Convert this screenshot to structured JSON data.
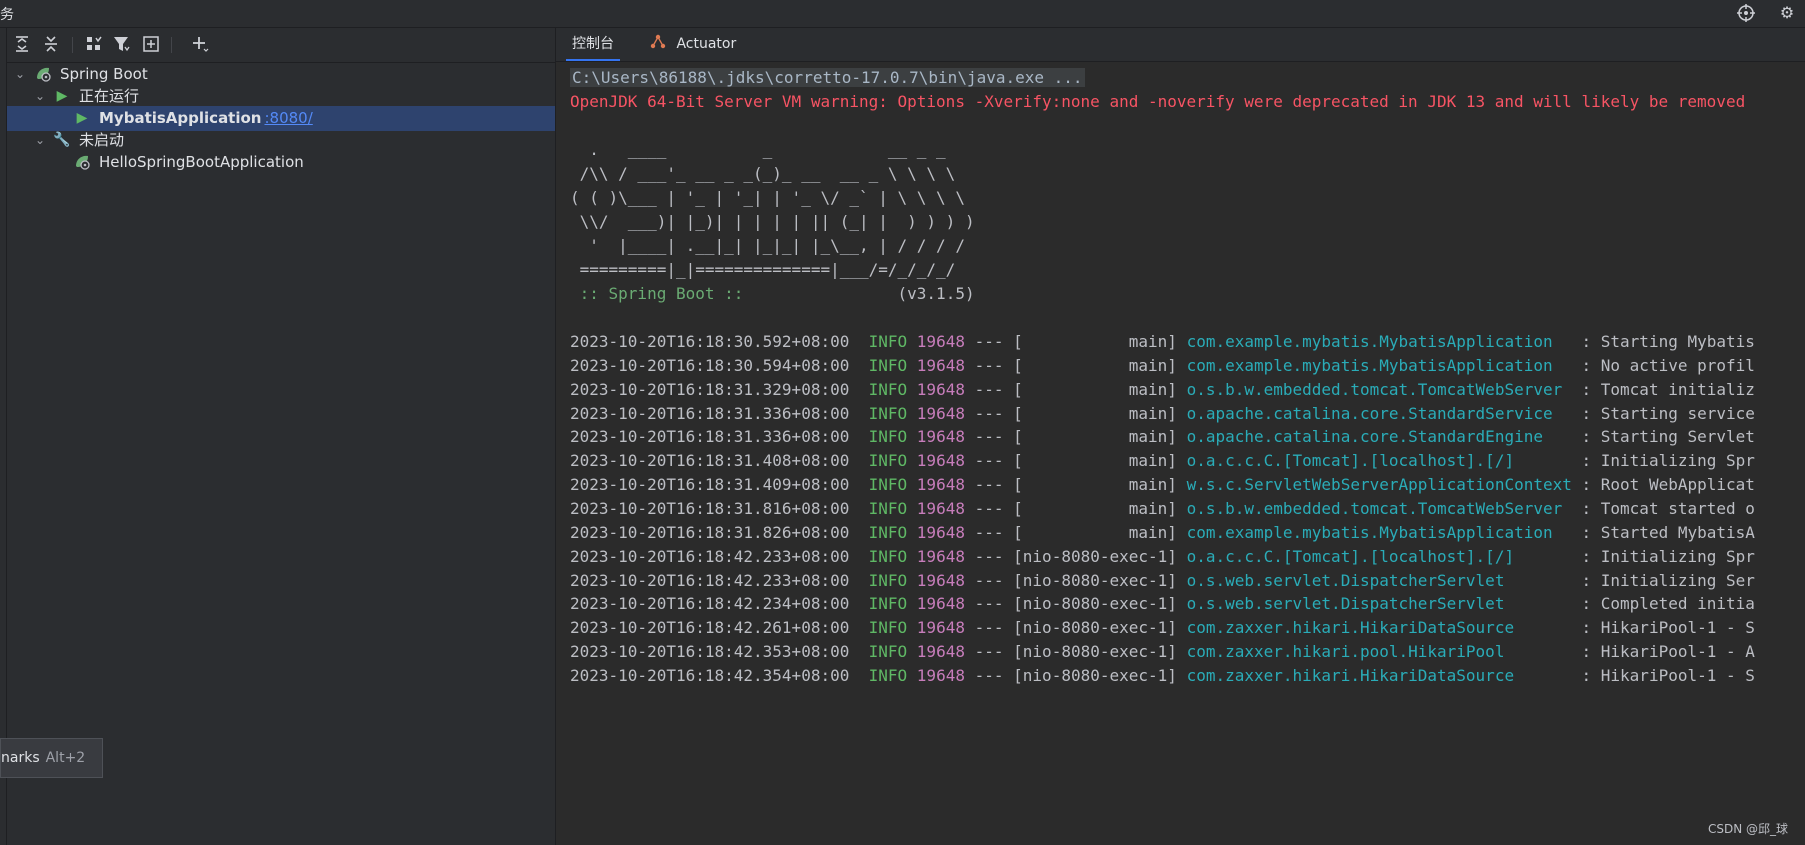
{
  "titlebar": {
    "title": "务",
    "target_icon": "target-icon",
    "gear_icon": "gear-icon"
  },
  "toolbar": {
    "icons": [
      "expand-all-icon",
      "collapse-all-icon",
      "group-by-icon",
      "filter-icon",
      "new-tab-icon",
      "add-icon"
    ]
  },
  "tree": {
    "root": {
      "label": "Spring Boot",
      "icon": "spring-boot-icon"
    },
    "running": {
      "label": "正在运行",
      "icon": "run-icon"
    },
    "app_running": {
      "label": "MybatisApplication",
      "port": ":8080/"
    },
    "not_started": {
      "label": "未启动",
      "icon": "wrench-icon"
    },
    "app_stopped": {
      "label": "HelloSpringBootApplication"
    }
  },
  "tooltip": {
    "label": "narks",
    "shortcut": "Alt+2"
  },
  "tabs": {
    "console": "控制台",
    "actuator": "Actuator"
  },
  "console": {
    "command": "C:\\Users\\86188\\.jdks\\corretto-17.0.7\\bin\\java.exe ...",
    "warning": "OpenJDK 64-Bit Server VM warning: Options -Xverify:none and -noverify were deprecated in JDK 13 and will likely be removed",
    "banner": [
      "  .   ____          _            __ _ _",
      " /\\\\ / ___'_ __ _ _(_)_ __  __ _ \\ \\ \\ \\",
      "( ( )\\___ | '_ | '_| | '_ \\/ _` | \\ \\ \\ \\",
      " \\\\/  ___)| |_)| | | | | || (_| |  ) ) ) )",
      "  '  |____| .__|_| |_|_| |_\\__, | / / / /",
      " =========|_|==============|___/=/_/_/_/"
    ],
    "spring_label": " :: Spring Boot :: ",
    "spring_version": "               (v3.1.5)",
    "logs": [
      {
        "ts": "2023-10-20T16:18:30.592+08:00",
        "level": "INFO",
        "pid": "19648",
        "sep": "---",
        "thread": "[           main]",
        "cls": "com.example.mybatis.MybatisApplication  ",
        "msg": " : Starting Mybatis"
      },
      {
        "ts": "2023-10-20T16:18:30.594+08:00",
        "level": "INFO",
        "pid": "19648",
        "sep": "---",
        "thread": "[           main]",
        "cls": "com.example.mybatis.MybatisApplication  ",
        "msg": " : No active profil"
      },
      {
        "ts": "2023-10-20T16:18:31.329+08:00",
        "level": "INFO",
        "pid": "19648",
        "sep": "---",
        "thread": "[           main]",
        "cls": "o.s.b.w.embedded.tomcat.TomcatWebServer ",
        "msg": " : Tomcat initializ"
      },
      {
        "ts": "2023-10-20T16:18:31.336+08:00",
        "level": "INFO",
        "pid": "19648",
        "sep": "---",
        "thread": "[           main]",
        "cls": "o.apache.catalina.core.StandardService  ",
        "msg": " : Starting service"
      },
      {
        "ts": "2023-10-20T16:18:31.336+08:00",
        "level": "INFO",
        "pid": "19648",
        "sep": "---",
        "thread": "[           main]",
        "cls": "o.apache.catalina.core.StandardEngine   ",
        "msg": " : Starting Servlet"
      },
      {
        "ts": "2023-10-20T16:18:31.408+08:00",
        "level": "INFO",
        "pid": "19648",
        "sep": "---",
        "thread": "[           main]",
        "cls": "o.a.c.c.C.[Tomcat].[localhost].[/]      ",
        "msg": " : Initializing Spr"
      },
      {
        "ts": "2023-10-20T16:18:31.409+08:00",
        "level": "INFO",
        "pid": "19648",
        "sep": "---",
        "thread": "[           main]",
        "cls": "w.s.c.ServletWebServerApplicationContext",
        "msg": " : Root WebApplicat"
      },
      {
        "ts": "2023-10-20T16:18:31.816+08:00",
        "level": "INFO",
        "pid": "19648",
        "sep": "---",
        "thread": "[           main]",
        "cls": "o.s.b.w.embedded.tomcat.TomcatWebServer ",
        "msg": " : Tomcat started o"
      },
      {
        "ts": "2023-10-20T16:18:31.826+08:00",
        "level": "INFO",
        "pid": "19648",
        "sep": "---",
        "thread": "[           main]",
        "cls": "com.example.mybatis.MybatisApplication  ",
        "msg": " : Started MybatisA"
      },
      {
        "ts": "2023-10-20T16:18:42.233+08:00",
        "level": "INFO",
        "pid": "19648",
        "sep": "---",
        "thread": "[nio-8080-exec-1]",
        "cls": "o.a.c.c.C.[Tomcat].[localhost].[/]      ",
        "msg": " : Initializing Spr"
      },
      {
        "ts": "2023-10-20T16:18:42.233+08:00",
        "level": "INFO",
        "pid": "19648",
        "sep": "---",
        "thread": "[nio-8080-exec-1]",
        "cls": "o.s.web.servlet.DispatcherServlet       ",
        "msg": " : Initializing Ser"
      },
      {
        "ts": "2023-10-20T16:18:42.234+08:00",
        "level": "INFO",
        "pid": "19648",
        "sep": "---",
        "thread": "[nio-8080-exec-1]",
        "cls": "o.s.web.servlet.DispatcherServlet       ",
        "msg": " : Completed initia"
      },
      {
        "ts": "2023-10-20T16:18:42.261+08:00",
        "level": "INFO",
        "pid": "19648",
        "sep": "---",
        "thread": "[nio-8080-exec-1]",
        "cls": "com.zaxxer.hikari.HikariDataSource      ",
        "msg": " : HikariPool-1 - S"
      },
      {
        "ts": "2023-10-20T16:18:42.353+08:00",
        "level": "INFO",
        "pid": "19648",
        "sep": "---",
        "thread": "[nio-8080-exec-1]",
        "cls": "com.zaxxer.hikari.pool.HikariPool       ",
        "msg": " : HikariPool-1 - A"
      },
      {
        "ts": "2023-10-20T16:18:42.354+08:00",
        "level": "INFO",
        "pid": "19648",
        "sep": "---",
        "thread": "[nio-8080-exec-1]",
        "cls": "com.zaxxer.hikari.HikariDataSource      ",
        "msg": " : HikariPool-1 - S"
      }
    ]
  },
  "watermark": "CSDN @邱_球"
}
